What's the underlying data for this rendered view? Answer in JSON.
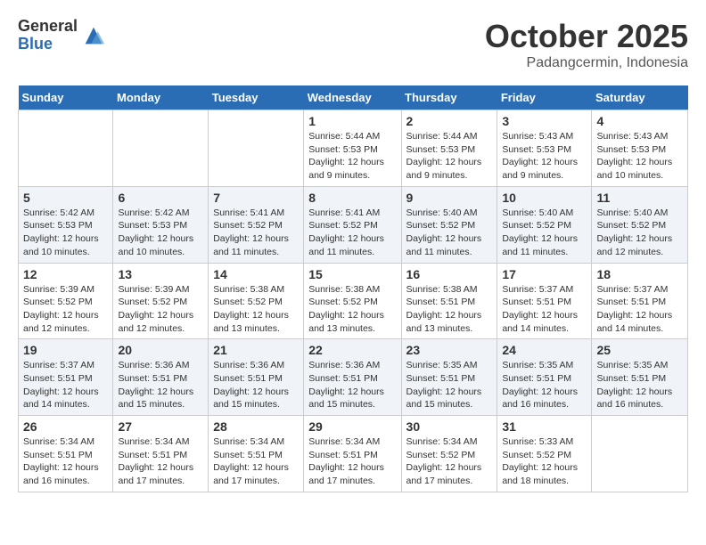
{
  "header": {
    "logo_general": "General",
    "logo_blue": "Blue",
    "month_title": "October 2025",
    "subtitle": "Padangcermin, Indonesia"
  },
  "days_of_week": [
    "Sunday",
    "Monday",
    "Tuesday",
    "Wednesday",
    "Thursday",
    "Friday",
    "Saturday"
  ],
  "weeks": [
    [
      {
        "day": "",
        "info": ""
      },
      {
        "day": "",
        "info": ""
      },
      {
        "day": "",
        "info": ""
      },
      {
        "day": "1",
        "info": "Sunrise: 5:44 AM\nSunset: 5:53 PM\nDaylight: 12 hours and 9 minutes."
      },
      {
        "day": "2",
        "info": "Sunrise: 5:44 AM\nSunset: 5:53 PM\nDaylight: 12 hours and 9 minutes."
      },
      {
        "day": "3",
        "info": "Sunrise: 5:43 AM\nSunset: 5:53 PM\nDaylight: 12 hours and 9 minutes."
      },
      {
        "day": "4",
        "info": "Sunrise: 5:43 AM\nSunset: 5:53 PM\nDaylight: 12 hours and 10 minutes."
      }
    ],
    [
      {
        "day": "5",
        "info": "Sunrise: 5:42 AM\nSunset: 5:53 PM\nDaylight: 12 hours and 10 minutes."
      },
      {
        "day": "6",
        "info": "Sunrise: 5:42 AM\nSunset: 5:53 PM\nDaylight: 12 hours and 10 minutes."
      },
      {
        "day": "7",
        "info": "Sunrise: 5:41 AM\nSunset: 5:52 PM\nDaylight: 12 hours and 11 minutes."
      },
      {
        "day": "8",
        "info": "Sunrise: 5:41 AM\nSunset: 5:52 PM\nDaylight: 12 hours and 11 minutes."
      },
      {
        "day": "9",
        "info": "Sunrise: 5:40 AM\nSunset: 5:52 PM\nDaylight: 12 hours and 11 minutes."
      },
      {
        "day": "10",
        "info": "Sunrise: 5:40 AM\nSunset: 5:52 PM\nDaylight: 12 hours and 11 minutes."
      },
      {
        "day": "11",
        "info": "Sunrise: 5:40 AM\nSunset: 5:52 PM\nDaylight: 12 hours and 12 minutes."
      }
    ],
    [
      {
        "day": "12",
        "info": "Sunrise: 5:39 AM\nSunset: 5:52 PM\nDaylight: 12 hours and 12 minutes."
      },
      {
        "day": "13",
        "info": "Sunrise: 5:39 AM\nSunset: 5:52 PM\nDaylight: 12 hours and 12 minutes."
      },
      {
        "day": "14",
        "info": "Sunrise: 5:38 AM\nSunset: 5:52 PM\nDaylight: 12 hours and 13 minutes."
      },
      {
        "day": "15",
        "info": "Sunrise: 5:38 AM\nSunset: 5:52 PM\nDaylight: 12 hours and 13 minutes."
      },
      {
        "day": "16",
        "info": "Sunrise: 5:38 AM\nSunset: 5:51 PM\nDaylight: 12 hours and 13 minutes."
      },
      {
        "day": "17",
        "info": "Sunrise: 5:37 AM\nSunset: 5:51 PM\nDaylight: 12 hours and 14 minutes."
      },
      {
        "day": "18",
        "info": "Sunrise: 5:37 AM\nSunset: 5:51 PM\nDaylight: 12 hours and 14 minutes."
      }
    ],
    [
      {
        "day": "19",
        "info": "Sunrise: 5:37 AM\nSunset: 5:51 PM\nDaylight: 12 hours and 14 minutes."
      },
      {
        "day": "20",
        "info": "Sunrise: 5:36 AM\nSunset: 5:51 PM\nDaylight: 12 hours and 15 minutes."
      },
      {
        "day": "21",
        "info": "Sunrise: 5:36 AM\nSunset: 5:51 PM\nDaylight: 12 hours and 15 minutes."
      },
      {
        "day": "22",
        "info": "Sunrise: 5:36 AM\nSunset: 5:51 PM\nDaylight: 12 hours and 15 minutes."
      },
      {
        "day": "23",
        "info": "Sunrise: 5:35 AM\nSunset: 5:51 PM\nDaylight: 12 hours and 15 minutes."
      },
      {
        "day": "24",
        "info": "Sunrise: 5:35 AM\nSunset: 5:51 PM\nDaylight: 12 hours and 16 minutes."
      },
      {
        "day": "25",
        "info": "Sunrise: 5:35 AM\nSunset: 5:51 PM\nDaylight: 12 hours and 16 minutes."
      }
    ],
    [
      {
        "day": "26",
        "info": "Sunrise: 5:34 AM\nSunset: 5:51 PM\nDaylight: 12 hours and 16 minutes."
      },
      {
        "day": "27",
        "info": "Sunrise: 5:34 AM\nSunset: 5:51 PM\nDaylight: 12 hours and 17 minutes."
      },
      {
        "day": "28",
        "info": "Sunrise: 5:34 AM\nSunset: 5:51 PM\nDaylight: 12 hours and 17 minutes."
      },
      {
        "day": "29",
        "info": "Sunrise: 5:34 AM\nSunset: 5:51 PM\nDaylight: 12 hours and 17 minutes."
      },
      {
        "day": "30",
        "info": "Sunrise: 5:34 AM\nSunset: 5:52 PM\nDaylight: 12 hours and 17 minutes."
      },
      {
        "day": "31",
        "info": "Sunrise: 5:33 AM\nSunset: 5:52 PM\nDaylight: 12 hours and 18 minutes."
      },
      {
        "day": "",
        "info": ""
      }
    ]
  ]
}
